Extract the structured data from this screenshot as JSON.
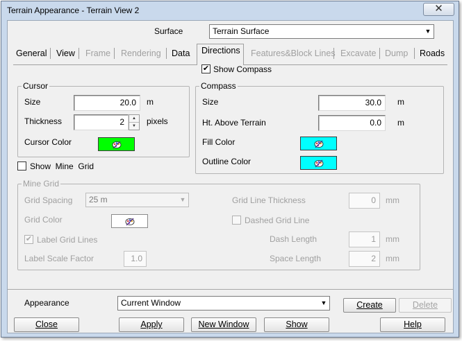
{
  "window": {
    "title": "Terrain Appearance - Terrain View 2",
    "close_glyph": "✕"
  },
  "surface": {
    "label": "Surface",
    "value": "Terrain Surface"
  },
  "tabs": [
    {
      "label": "General",
      "enabled": true
    },
    {
      "label": "View",
      "enabled": true
    },
    {
      "label": "Frame",
      "enabled": false
    },
    {
      "label": "Rendering",
      "enabled": false
    },
    {
      "label": "Data",
      "enabled": true
    },
    {
      "label": "Directions",
      "enabled": true,
      "selected": true
    },
    {
      "label": "Features&Block Lines",
      "enabled": false
    },
    {
      "label": "Excavate",
      "enabled": false
    },
    {
      "label": "Dump",
      "enabled": false
    },
    {
      "label": "Roads",
      "enabled": true
    }
  ],
  "show_compass": {
    "label": "Show Compass",
    "checked": true
  },
  "cursor": {
    "title": "Cursor",
    "size_label": "Size",
    "size_value": "20.0",
    "size_unit": "m",
    "thickness_label": "Thickness",
    "thickness_value": "2",
    "thickness_unit": "pixels",
    "color_label": "Cursor Color",
    "color": "#00ff00"
  },
  "compass": {
    "title": "Compass",
    "size_label": "Size",
    "size_value": "30.0",
    "size_unit": "m",
    "height_label": "Ht. Above Terrain",
    "height_value": "0.0",
    "height_unit": "m",
    "fill_label": "Fill Color",
    "fill_color": "#00ffff",
    "outline_label": "Outline Color",
    "outline_color": "#00ffff"
  },
  "show_mine_grid": {
    "label": "Show  Mine  Grid",
    "checked": false
  },
  "mine_grid": {
    "title": "Mine Grid",
    "spacing_label": "Grid Spacing",
    "spacing_value": "25 m",
    "color_label": "Grid Color",
    "color": "#ffffff",
    "label_lines_label": "Label Grid Lines",
    "label_lines_checked": true,
    "scale_label": "Label Scale Factor",
    "scale_value": "1.0",
    "thickness_label": "Grid Line Thickness",
    "thickness_value": "0",
    "thickness_unit": "mm",
    "dashed_label": "Dashed Grid Line",
    "dashed_checked": false,
    "dash_label": "Dash Length",
    "dash_value": "1",
    "dash_unit": "mm",
    "space_label": "Space Length",
    "space_value": "2",
    "space_unit": "mm"
  },
  "appearance": {
    "label": "Appearance",
    "value": "Current Window",
    "create": "Create",
    "delete": "Delete"
  },
  "buttons": {
    "close": "Close",
    "apply": "Apply",
    "new_window": "New Window",
    "show": "Show",
    "help": "Help"
  },
  "icons": {
    "close": "close-icon",
    "dropdown": "chevron-down-icon",
    "palette": "palette-icon",
    "spin": "spin-arrows-icon"
  }
}
